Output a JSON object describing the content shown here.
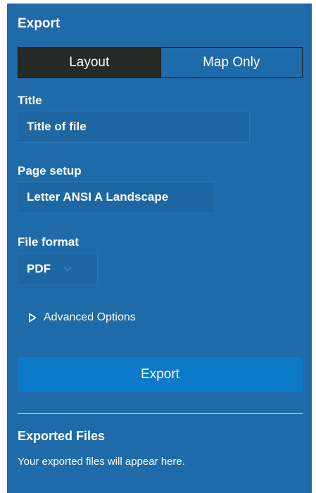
{
  "panel": {
    "title": "Export",
    "background_color": "#1f6aa8"
  },
  "mode_toggle": {
    "options": [
      {
        "label": "Layout",
        "selected": true
      },
      {
        "label": "Map Only",
        "selected": false
      }
    ]
  },
  "fields": {
    "title": {
      "label": "Title",
      "value": "Title of file"
    },
    "page_setup": {
      "label": "Page setup",
      "value": "Letter ANSI A Landscape"
    },
    "file_format": {
      "label": "File format",
      "value": "PDF",
      "icon": "chevron-down-icon"
    }
  },
  "advanced_options": {
    "label": "Advanced Options",
    "icon": "caret-right-icon",
    "expanded": false
  },
  "export_button": {
    "label": "Export",
    "color": "#0d79c9"
  },
  "exported_files": {
    "title": "Exported Files",
    "empty_message": "Your exported files will appear here."
  }
}
